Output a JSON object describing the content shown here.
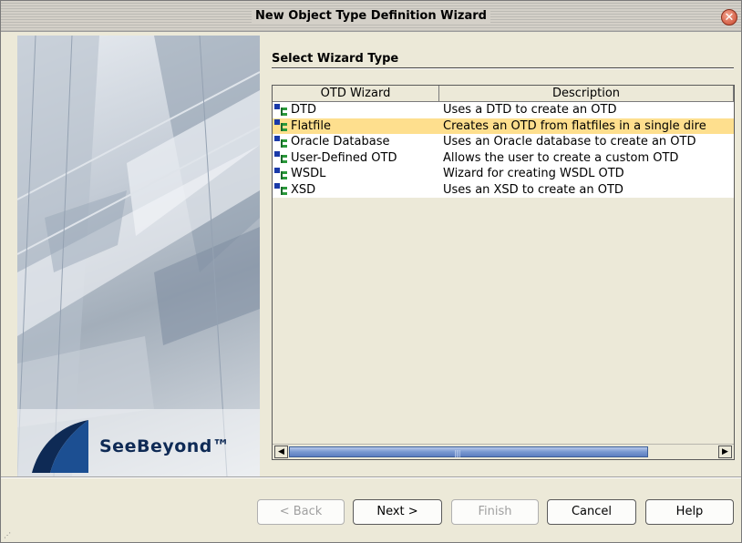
{
  "window": {
    "title": "New Object Type Definition Wizard",
    "close_glyph": "✕"
  },
  "branding": {
    "logo_text": "SeeBeyond™"
  },
  "main": {
    "heading": "Select Wizard Type"
  },
  "table": {
    "columns": [
      "OTD Wizard",
      "Description"
    ],
    "rows": [
      {
        "name": "DTD",
        "description": "Uses a DTD to create an OTD",
        "selected": false
      },
      {
        "name": "Flatfile",
        "description": "Creates an OTD from flatfiles in a single dire",
        "selected": true
      },
      {
        "name": "Oracle Database",
        "description": "Uses an Oracle database to create an OTD",
        "selected": false
      },
      {
        "name": "User-Defined OTD",
        "description": "Allows the user to create a custom OTD",
        "selected": false
      },
      {
        "name": "WSDL",
        "description": "Wizard for creating WSDL OTD",
        "selected": false
      },
      {
        "name": "XSD",
        "description": "Uses an XSD to create an OTD",
        "selected": false
      }
    ],
    "scroll": {
      "left_glyph": "◀",
      "right_glyph": "▶",
      "grip": "||||"
    }
  },
  "buttons": {
    "back": "< Back",
    "next": "Next >",
    "finish": "Finish",
    "cancel": "Cancel",
    "help": "Help"
  },
  "colors": {
    "selection": "#fedf8e",
    "scroll_thumb": "#7898d0",
    "logo": "#0e2a55"
  }
}
